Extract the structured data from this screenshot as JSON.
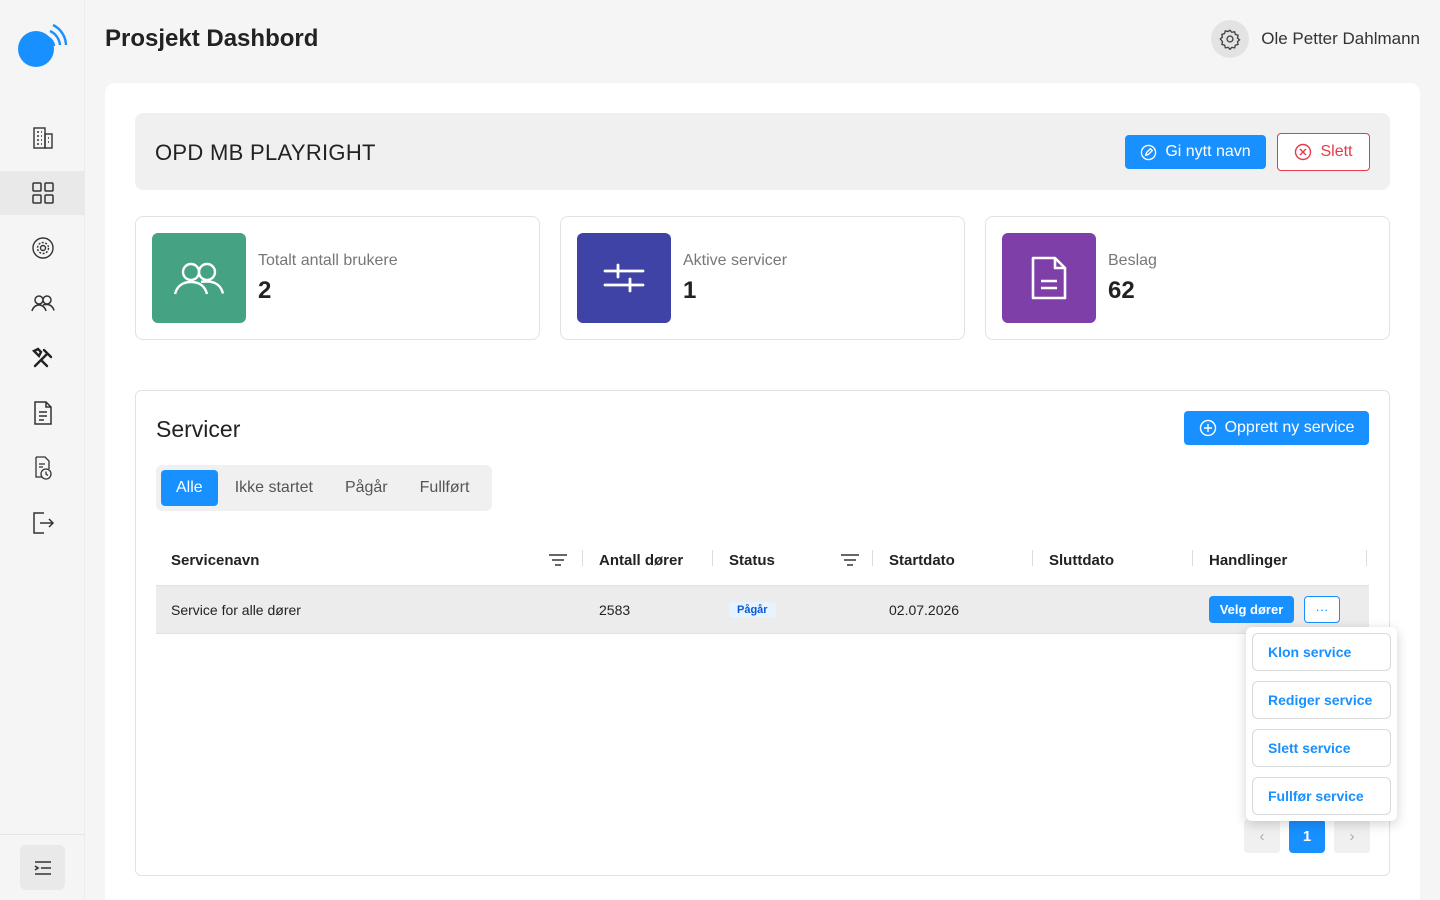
{
  "header": {
    "title": "Prosjekt Dashbord",
    "user_name": "Ole Petter Dahlmann"
  },
  "sidebar": {
    "items": [
      {
        "icon": "building-icon"
      },
      {
        "icon": "dashboard-grid-icon",
        "active": true
      },
      {
        "icon": "gear-circle-icon"
      },
      {
        "icon": "users-icon"
      },
      {
        "icon": "tools-icon"
      },
      {
        "icon": "document-icon"
      },
      {
        "icon": "document-clock-icon"
      },
      {
        "icon": "logout-icon"
      }
    ],
    "collapse_icon": "menu-collapse-icon"
  },
  "project": {
    "name": "OPD MB PLAYRIGHT",
    "rename_label": "Gi nytt navn",
    "delete_label": "Slett"
  },
  "stats": [
    {
      "label": "Totalt antall brukere",
      "value": "2",
      "color": "#45a283"
    },
    {
      "label": "Aktive servicer",
      "value": "1",
      "color": "#3f43a5"
    },
    {
      "label": "Beslag",
      "value": "62",
      "color": "#7e3fa8"
    }
  ],
  "services": {
    "title": "Servicer",
    "create_label": "Opprett ny service",
    "tabs": [
      "Alle",
      "Ikke startet",
      "Pågår",
      "Fullført"
    ],
    "active_tab": "Alle",
    "columns": [
      "Servicenavn",
      "Antall dører",
      "Status",
      "Startdato",
      "Sluttdato",
      "Handlinger"
    ],
    "rows": [
      {
        "name": "Service for alle dører",
        "doors": "2583",
        "status": "Pågår",
        "start": "02.07.2026",
        "end": "",
        "action_label": "Velg dører",
        "more_label": "···"
      }
    ],
    "pagination": {
      "prev": "‹",
      "current": "1",
      "next": "›"
    }
  },
  "dropdown": {
    "items": [
      "Klon service",
      "Rediger service",
      "Slett service",
      "Fullfør service"
    ]
  },
  "colors": {
    "accent": "#1890ff",
    "danger": "#e6394a"
  }
}
